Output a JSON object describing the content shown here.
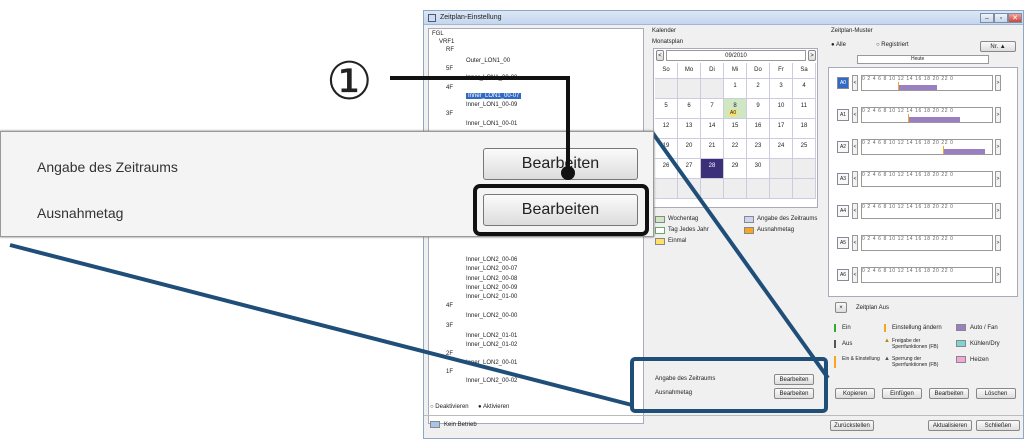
{
  "window": {
    "title": "Zeitplan-Einstellung",
    "min": "–",
    "max": "▫",
    "close": "✕"
  },
  "tree": {
    "items": [
      "FGL",
      "VRF1",
      "RF",
      "Outer_LON1_00",
      "5F",
      "Inner_LON1_00-00",
      "4F",
      "Inner_LON1_00-07",
      "Inner_LON1_00-09",
      "3F",
      "Inner_LON1_00-01"
    ],
    "lower_items": [
      "Inner_LON2_00-06",
      "Inner_LON2_00-07",
      "Inner_LON2_00-08",
      "Inner_LON2_00-09",
      "Inner_LON2_01-00",
      "4F",
      "Inner_LON2_00-00",
      "3F",
      "Inner_LON2_01-01",
      "Inner_LON2_01-02",
      "2F",
      "Inner_LON2_00-01",
      "1F",
      "Inner_LON2_00-02"
    ],
    "deactivate": "Deaktivieren",
    "activate": "Aktivieren"
  },
  "calendar": {
    "header": "Kalender",
    "subheader": "Monatsplan",
    "month": "09/2010",
    "prev": "<",
    "next": ">",
    "days": [
      "So",
      "Mo",
      "Di",
      "Mi",
      "Do",
      "Fr",
      "Sa"
    ],
    "rows": [
      [
        "",
        "",
        "",
        "1",
        "2",
        "3",
        "4"
      ],
      [
        "5",
        "6",
        "7",
        "8",
        "9",
        "10",
        "11"
      ],
      [
        "12",
        "13",
        "14",
        "15",
        "16",
        "17",
        "18"
      ],
      [
        "19",
        "20",
        "21",
        "22",
        "23",
        "24",
        "25"
      ],
      [
        "26",
        "27",
        "28",
        "29",
        "30",
        "",
        ""
      ],
      [
        "",
        "",
        "",
        "",
        "",
        "",
        ""
      ]
    ],
    "marker_a0": "A0",
    "legend": {
      "wochentag": "Wochentag",
      "tag_jedes_jahr": "Tag Jedes Jahr",
      "einmal": "Einmal",
      "angabe_zeitraum": "Angabe des Zeitraums",
      "ausnahmetag": "Ausnahmetag"
    }
  },
  "bottom_left": {
    "angabe": "Angabe des Zeitraums",
    "ausnahmetag": "Ausnahmetag",
    "edit1": "Bearbeiten",
    "edit2": "Bearbeiten"
  },
  "patterns": {
    "header": "Zeitplan-Muster",
    "alle": "Alle",
    "registriert": "Registriert",
    "sort": "Nr. ▲",
    "heute": "Heute",
    "ticks": "0 2 4 6 8 10 12 14 16 18 20 22 0",
    "rows": [
      "A0",
      "A1",
      "A2",
      "A3",
      "A4",
      "A5",
      "A6"
    ],
    "off_btn": "×",
    "off_label": "Zeitplan Aus",
    "legend": {
      "ein": "Ein",
      "aus": "Aus",
      "ein_einst": "Ein & Einstellung",
      "einst_aendern": "Einstellung ändern",
      "freigabe": "Freigabe der Sperrfunktionen (FB)",
      "sperrung": "Sperrung der Sperrfunktionen (FB)",
      "auto_fan": "Auto / Fan",
      "kuehlen": "Kühlen/Dry",
      "heizen": "Heizen"
    },
    "buttons": [
      "Kopieren",
      "Einfügen",
      "Bearbeiten",
      "Löschen"
    ]
  },
  "footer": {
    "status": "Kein Betrieb",
    "reset": "Zurückstellen",
    "update": "Aktualisieren",
    "close": "Schließen"
  },
  "zoom": {
    "angabe": "Angabe des Zeitraums",
    "ausnahmetag": "Ausnahmetag",
    "edit1": "Bearbeiten",
    "edit2": "Bearbeiten"
  },
  "callout": {
    "number": "①"
  },
  "colors": {
    "accent": "#316ac5",
    "purple": "#9b7fc3",
    "orange": "#f6a623",
    "green": "#9ad18b",
    "highlight_border": "#1f4e79"
  }
}
